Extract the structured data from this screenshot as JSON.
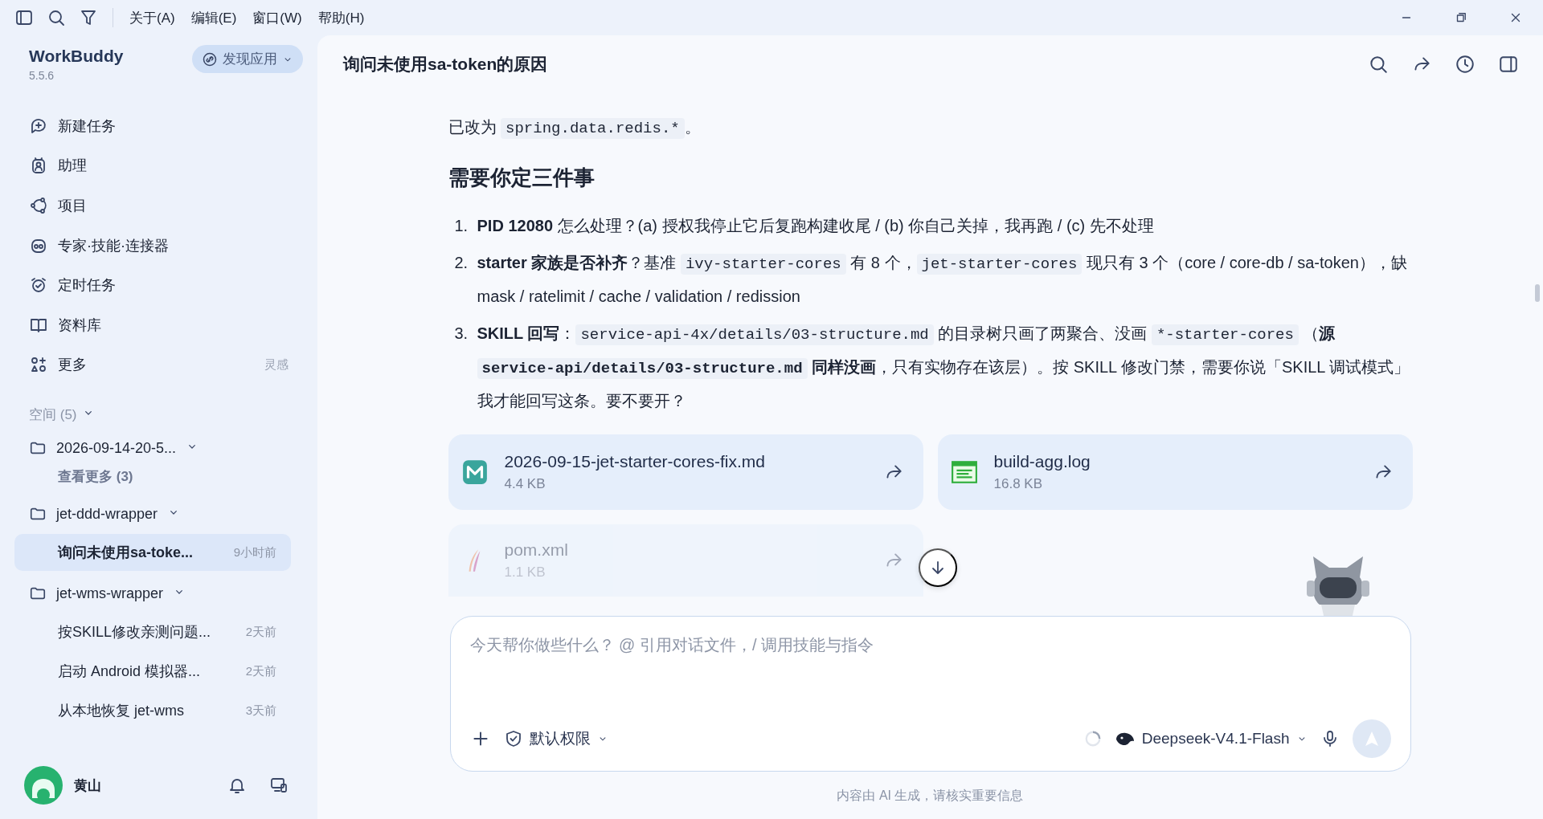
{
  "menu": [
    "关于(A)",
    "编辑(E)",
    "窗口(W)",
    "帮助(H)"
  ],
  "app": {
    "name": "WorkBuddy",
    "version": "5.5.6",
    "discover": "发现应用"
  },
  "nav": [
    {
      "label": "新建任务"
    },
    {
      "label": "助理"
    },
    {
      "label": "项目"
    },
    {
      "label": "专家·技能·连接器"
    },
    {
      "label": "定时任务"
    },
    {
      "label": "资料库"
    },
    {
      "label": "更多",
      "hint": "灵感"
    }
  ],
  "spaces": {
    "label": "空间 (5)",
    "expanded": true,
    "groups": [
      {
        "name": "2026-09-14-20-5...",
        "expanded": true,
        "more": "查看更多 (3)"
      },
      {
        "name": "jet-ddd-wrapper",
        "expanded": true,
        "children": [
          {
            "title": "询问未使用sa-toke...",
            "time": "9小时前",
            "selected": true
          }
        ]
      },
      {
        "name": "jet-wms-wrapper",
        "expanded": true,
        "children": [
          {
            "title": "按SKILL修改亲测问题...",
            "time": "2天前",
            "selected": false
          },
          {
            "title": "启动 Android 模拟器...",
            "time": "2天前",
            "selected": false
          },
          {
            "title": "从本地恢复 jet-wms",
            "time": "3天前",
            "selected": false
          }
        ]
      }
    ]
  },
  "user": {
    "name": "黄山"
  },
  "chat": {
    "title": "询问未使用sa-token的原因",
    "blocks": [
      {
        "kind": "paragraph",
        "segments": [
          {
            "kind": "text",
            "text": "已改为 "
          },
          {
            "kind": "code",
            "text": "spring.data.redis.*"
          },
          {
            "kind": "text",
            "text": "。"
          }
        ]
      },
      {
        "kind": "heading",
        "text": "需要你定三件事"
      },
      {
        "kind": "list",
        "items": [
          {
            "number": "1.",
            "segments": [
              {
                "kind": "text",
                "text": "**PID 12080** 怎么处理？(a) 授权我停止它后复跑构建收尾 / (b) 你自己关掉，我再跑 / (c) 先不处理"
              }
            ]
          },
          {
            "number": "2.",
            "segments": [
              {
                "kind": "text",
                "text": "**starter 家族是否补齐**？基准 "
              },
              {
                "kind": "code",
                "text": "ivy-starter-cores"
              },
              {
                "kind": "text",
                "text": " 有 8 个，"
              },
              {
                "kind": "code",
                "text": "jet-starter-cores"
              },
              {
                "kind": "text",
                "text": " 现只有 3 个（core / core-db / sa-token），缺 mask / ratelimit / cache / validation / redission"
              }
            ]
          },
          {
            "number": "3.",
            "segments": [
              {
                "kind": "text",
                "text": "**SKILL 回写**："
              },
              {
                "kind": "code",
                "text": "service-api-4x/details/03-structure.md"
              },
              {
                "kind": "text",
                "text": " 的目录树只画了两聚合、没画 "
              },
              {
                "kind": "code",
                "text": "*-starter-cores"
              },
              {
                "kind": "text",
                "text": " （**源** "
              },
              {
                "kind": "code",
                "text": "service-api/details/03-structure.md",
                "bold": true
              },
              {
                "kind": "text",
                "text": " **同样没画**，只有实物存在该层）。按 SKILL 修改门禁，需要你说「SKILL 调试模式」我才能回写这条。要不要开？"
              }
            ]
          }
        ]
      }
    ]
  },
  "files": [
    {
      "name": "2026-09-15-jet-starter-cores-fix.md",
      "size": "4.4 KB",
      "kind": "markdown",
      "faded": false
    },
    {
      "name": "build-agg.log",
      "size": "16.8 KB",
      "kind": "log",
      "faded": false
    },
    {
      "name": "pom.xml",
      "size": "1.1 KB",
      "kind": "xml",
      "faded": true
    }
  ],
  "composer": {
    "placeholder": "今天帮你做些什么？ @ 引用对话文件，/ 调用技能与指令",
    "permission": "默认权限",
    "model": "Deepseek-V4.1-Flash"
  },
  "footer": "内容由 AI 生成，请核实重要信息"
}
